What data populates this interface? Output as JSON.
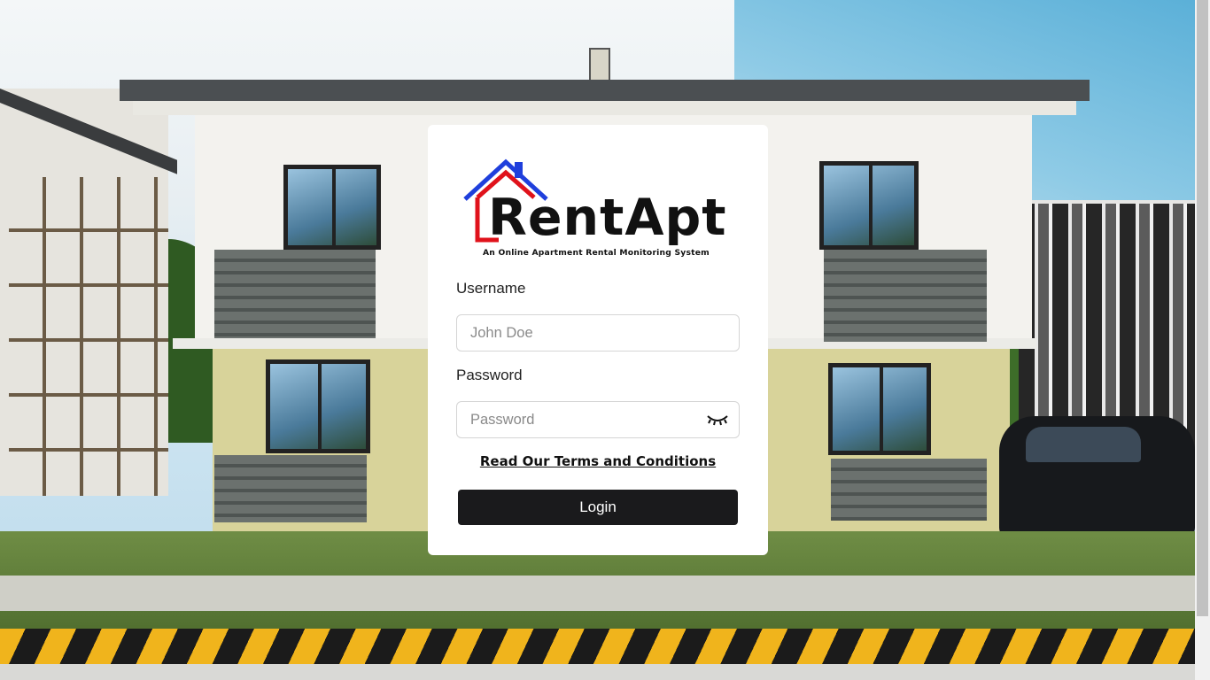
{
  "brand": {
    "name": "RentApt",
    "tagline": "An Online Apartment Rental Monitoring System",
    "colors": {
      "roof_blue": "#1f3fdc",
      "house_red": "#e0121b",
      "text": "#111111"
    }
  },
  "form": {
    "username_label": "Username",
    "username_placeholder": "John Doe",
    "username_value": "",
    "password_label": "Password",
    "password_placeholder": "Password",
    "password_value": "",
    "password_toggle_icon": "eye-closed-icon",
    "terms_link": "Read Our Terms and Conditions",
    "login_label": "Login"
  },
  "theme": {
    "button_bg": "#1a1a1c",
    "card_bg": "#ffffff"
  }
}
